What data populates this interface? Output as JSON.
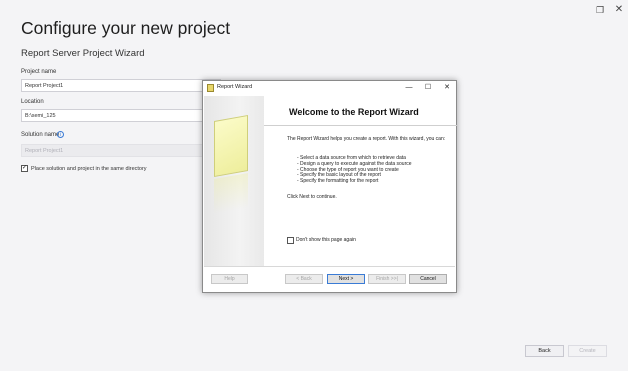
{
  "window": {
    "restore_icon": "restore-icon",
    "close_icon": "close-icon",
    "restore_glyph": "❐",
    "close_glyph": "✕"
  },
  "page": {
    "title": "Configure your new project",
    "subtitle": "Report Server Project Wizard"
  },
  "form": {
    "project_name_label": "Project name",
    "project_name_value": "Report Project1",
    "location_label": "Location",
    "location_value": "B:\\semi_125",
    "solution_name_label": "Solution name",
    "solution_name_value": "Report Project1",
    "info_glyph": "i",
    "place_same_dir_label": "Place solution and project in the same directory",
    "place_same_dir_checked": true,
    "check_glyph": "✓"
  },
  "footer": {
    "back_label": "Back",
    "create_label": "Create"
  },
  "dialog": {
    "title": "Report Wizard",
    "minimize_glyph": "—",
    "maximize_glyph": "☐",
    "close_glyph": "✕",
    "heading": "Welcome to the Report Wizard",
    "intro": "The Report Wizard helps you create a report. With this wizard, you can:",
    "steps": [
      "- Select a data source from which to retrieve data",
      "- Design a query to execute against the data source",
      "- Choose the type of report you want to create",
      "- Specify the basic layout of the report",
      "- Specify the formatting for the report"
    ],
    "next_hint": "Click Next to continue.",
    "dont_show_label": "Don't show this page again",
    "dont_show_checked": false,
    "buttons": {
      "help": "Help",
      "back": "< Back",
      "next": "Next >",
      "finish": "Finish >>|",
      "cancel": "Cancel"
    }
  }
}
